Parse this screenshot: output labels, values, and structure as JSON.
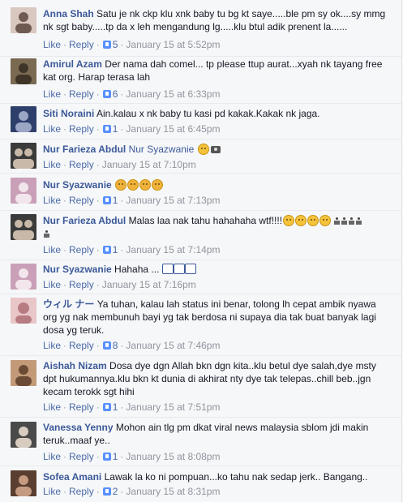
{
  "comments": [
    {
      "author": "Anna Shah",
      "text": "Satu je nk ckp klu xnk baby tu bg kt saye.....ble pm sy ok....sy mmg nk sgt baby.....tp da x leh mengandung lg.....klu btul adik prenent la......",
      "like": "Like",
      "reply": "Reply",
      "likes": "5",
      "time": "January 15 at 5:52pm",
      "avatar": {
        "bg": "#d9c8c0",
        "fg": "#6f5a52"
      }
    },
    {
      "author": "Amirul Azam",
      "text": "Der nama dah comel... tp please ttup aurat...xyah nk tayang free kat org. Harap terasa lah",
      "like": "Like",
      "reply": "Reply",
      "likes": "6",
      "time": "January 15 at 6:33pm",
      "avatar": {
        "bg": "#7a6a52",
        "fg": "#3e3428"
      }
    },
    {
      "author": "Siti Noraini",
      "text": "Ain.kalau x nk baby tu kasi pd kakak.Kakak nk jaga.",
      "like": "Like",
      "reply": "Reply",
      "likes": "1",
      "time": "January 15 at 6:45pm",
      "avatar": {
        "bg": "#2e3f6c",
        "fg": "#9aa6c4"
      }
    },
    {
      "author": "Nur Farieza Abdul",
      "text": "Nur Syazwanie",
      "like": "Like",
      "reply": "Reply",
      "likes": "",
      "time": "January 15 at 7:10pm",
      "avatar": {
        "bg": "#3b3b3b",
        "fg": "#c9b9a8"
      }
    },
    {
      "author": "Nur Syazwanie",
      "text": "",
      "like": "Like",
      "reply": "Reply",
      "likes": "1",
      "time": "January 15 at 7:13pm",
      "avatar": {
        "bg": "#c9a0b8",
        "fg": "#f2e6ec"
      }
    },
    {
      "author": "Nur Farieza Abdul",
      "text": "Malas laa nak tahu hahahaha wtf!!!!",
      "like": "Like",
      "reply": "Reply",
      "likes": "1",
      "time": "January 15 at 7:14pm",
      "avatar": {
        "bg": "#3b3b3b",
        "fg": "#c9b9a8"
      }
    },
    {
      "author": "Nur Syazwanie",
      "text": "Hahaha ...",
      "like": "Like",
      "reply": "Reply",
      "likes": "",
      "time": "January 15 at 7:16pm",
      "avatar": {
        "bg": "#c9a0b8",
        "fg": "#f2e6ec"
      }
    },
    {
      "author": "ウィル ナー",
      "text": "Ya tuhan, kalau lah status ini benar, tolong lh cepat ambik nyawa org yg nak membunuh bayi yg tak berdosa ni supaya dia tak buat banyak lagi dosa yg teruk.",
      "like": "Like",
      "reply": "Reply",
      "likes": "8",
      "time": "January 15 at 7:46pm",
      "avatar": {
        "bg": "#e9c6c8",
        "fg": "#b77c82"
      }
    },
    {
      "author": "Aishah Nizam",
      "text": "Dosa dye dgn Allah bkn dgn kita..klu betul dye salah,dye msty dpt hukumannya.klu bkn kt dunia di akhirat nty dye tak telepas..chill beb..jgn kecam terokk sgt hihi",
      "like": "Like",
      "reply": "Reply",
      "likes": "1",
      "time": "January 15 at 7:51pm",
      "avatar": {
        "bg": "#c29a78",
        "fg": "#6b4b36"
      }
    },
    {
      "author": "Vanessa Yenny",
      "text": "Mohon ain tlg pm dkat viral news malaysia sblom jdi makin teruk..maaf ye..",
      "like": "Like",
      "reply": "Reply",
      "likes": "1",
      "time": "January 15 at 8:08pm",
      "avatar": {
        "bg": "#4a4a4a",
        "fg": "#d8cbbf"
      }
    },
    {
      "author": "Sofea Amani",
      "text": "Lawak la ko ni pompuan...ko tahu nak sedap jerk.. Bangang..",
      "like": "Like",
      "reply": "Reply",
      "likes": "2",
      "time": "January 15 at 8:31pm",
      "avatar": {
        "bg": "#5a3e30",
        "fg": "#c49a80"
      }
    }
  ]
}
